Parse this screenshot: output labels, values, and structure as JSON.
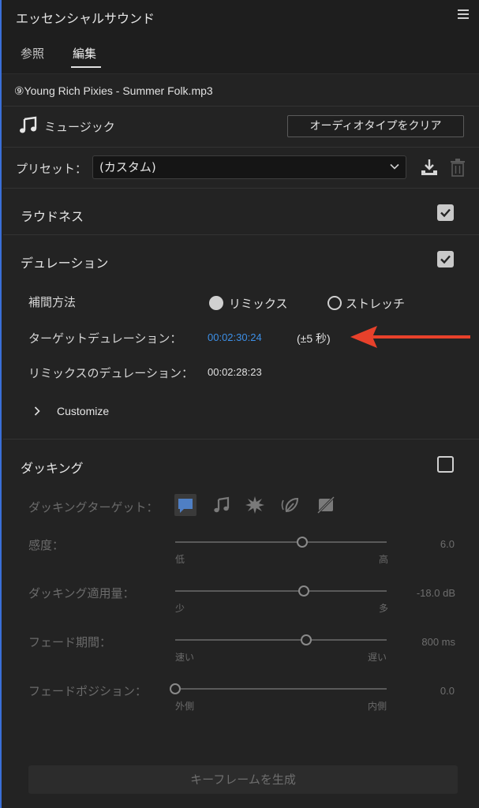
{
  "panel": {
    "title": "エッセンシャルサウンド"
  },
  "tabs": [
    {
      "label": "参照"
    },
    {
      "label": "編集"
    }
  ],
  "file": {
    "name": "⑨Young Rich Pixies - Summer Folk.mp3"
  },
  "audio_type": {
    "label": "ミュージック",
    "clear_button": "オーディオタイプをクリア"
  },
  "preset": {
    "label": "プリセット：",
    "value": "(カスタム)"
  },
  "loudness": {
    "title": "ラウドネス",
    "checked": true
  },
  "duration": {
    "title": "デュレーション",
    "checked": true,
    "method_label": "補間方法",
    "option_remix": "リミックス",
    "option_stretch": "ストレッチ",
    "target_label": "ターゲットデュレーション：",
    "target_value": "00:02:30:24",
    "tolerance": "(±5 秒)",
    "remix_label": "リミックスのデュレーション：",
    "remix_value": "00:02:28:23",
    "customize": "Customize"
  },
  "ducking": {
    "title": "ダッキング",
    "checked": false,
    "target_label": "ダッキングターゲット：",
    "sensitivity": {
      "label": "感度：",
      "value": "6.0",
      "min": "低",
      "max": "高",
      "level": 0.6
    },
    "amount": {
      "label": "ダッキング適用量：",
      "value": "-18.0 dB",
      "min": "少",
      "max": "多",
      "level": 0.61
    },
    "fade_duration": {
      "label": "フェード期間：",
      "value": "800 ms",
      "min": "速い",
      "max": "遅い",
      "level": 0.62
    },
    "fade_position": {
      "label": "フェードポジション：",
      "value": "0.0",
      "min": "外側",
      "max": "内側",
      "level": 0.0
    },
    "keyframe_button": "キーフレームを生成"
  },
  "colors": {
    "accent_blue": "#3d8fe6",
    "arrow_red": "#e8412b"
  }
}
